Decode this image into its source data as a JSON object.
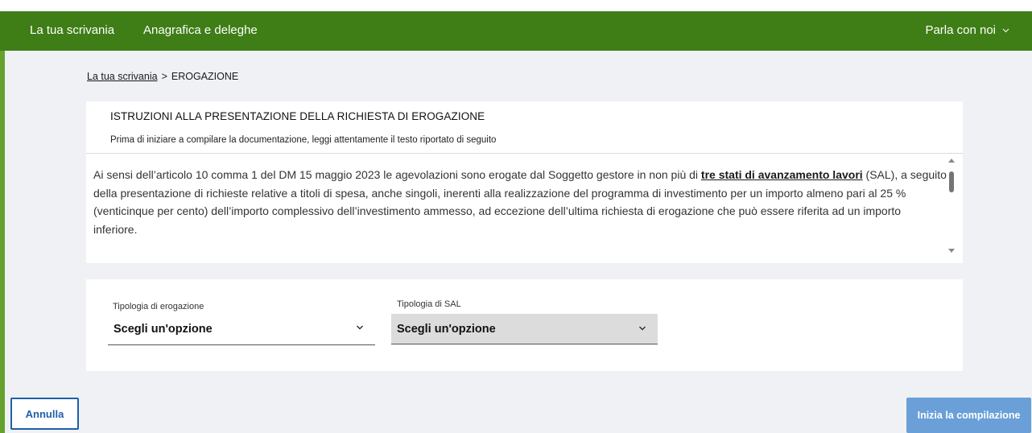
{
  "nav": {
    "desk_label": "La tua scrivania",
    "registry_label": "Anagrafica e deleghe",
    "talk_label": "Parla con noi"
  },
  "breadcrumb": {
    "home": "La tua scrivania",
    "separator": ">",
    "current": "EROGAZIONE"
  },
  "instructions": {
    "title": "ISTRUZIONI ALLA PRESENTAZIONE DELLA RICHIESTA DI EROGAZIONE",
    "subtitle": "Prima di iniziare a compilare la documentazione, leggi attentamente il testo riportato di seguito",
    "body_before": "Ai sensi dell’articolo 10 comma 1 del DM 15 maggio 2023 le agevolazioni sono erogate dal Soggetto gestore in non più di ",
    "body_link": "tre stati di avanzamento lavori",
    "body_after": " (SAL), a seguito della presentazione di richieste relative a titoli di spesa, anche singoli, inerenti alla realizzazione del programma di investimento per un importo almeno pari al 25 % (venticinque per cento) dell’importo complessivo dell’investimento ammesso, ad eccezione dell’ultima richiesta di erogazione che può essere riferita ad un importo inferiore."
  },
  "form": {
    "erogazione": {
      "label": "Tipologia di erogazione",
      "value": "Scegli un'opzione"
    },
    "sal": {
      "label": "Tipologia di SAL",
      "value": "Scegli un'opzione"
    }
  },
  "actions": {
    "cancel_label": "Annulla",
    "start_label": "Inizia la compilazione"
  },
  "colors": {
    "nav_bg": "#3f7d17",
    "accent_border": "#64a12d",
    "primary": "#1f5fa8",
    "primary_disabled": "#6a9fd8"
  },
  "icons": {
    "nav_talk": "chevron-down-icon",
    "select": "chevron-down-icon"
  }
}
